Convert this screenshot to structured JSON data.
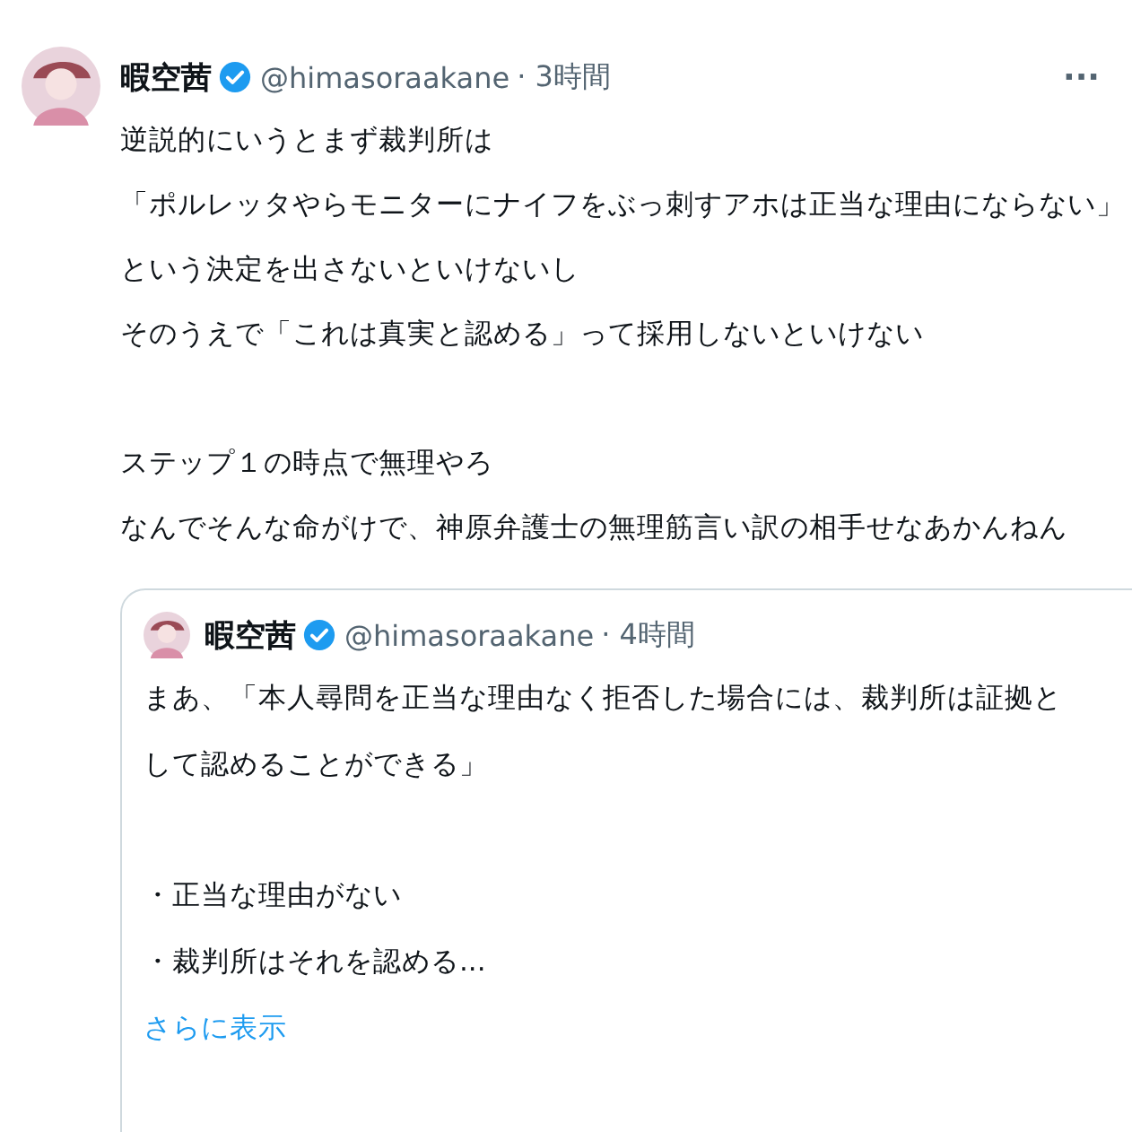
{
  "tweet": {
    "author": {
      "name": "暇空茜",
      "verified": true,
      "handle": "@himasoraakane",
      "time": "· 3時間"
    },
    "paragraphs": [
      [
        "逆説的にいうとまず裁判所は",
        "「ポルレッタやらモニターにナイフをぶっ刺すアホは正当な理由にならない」",
        "という決定を出さないといけないし",
        "そのうえで「これは真実と認める」って採用しないといけない"
      ],
      [
        "ステップ１の時点で無理やろ",
        "なんでそんな命がけで、神原弁護士の無理筋言い訳の相手せなあかんねん"
      ]
    ],
    "more_menu": "···",
    "quoted_tweet": {
      "author": {
        "name": "暇空茜",
        "verified": true,
        "handle": "@himasoraakane",
        "time": "· 4時間"
      },
      "paragraphs": [
        [
          "まあ、「本人尋問を正当な理由なく拒否した場合には、裁判所は証拠として認めることができる」"
        ],
        [
          "・正当な理由がない",
          "・裁判所はそれを認める..."
        ]
      ],
      "show_more": "さらに表示"
    }
  }
}
